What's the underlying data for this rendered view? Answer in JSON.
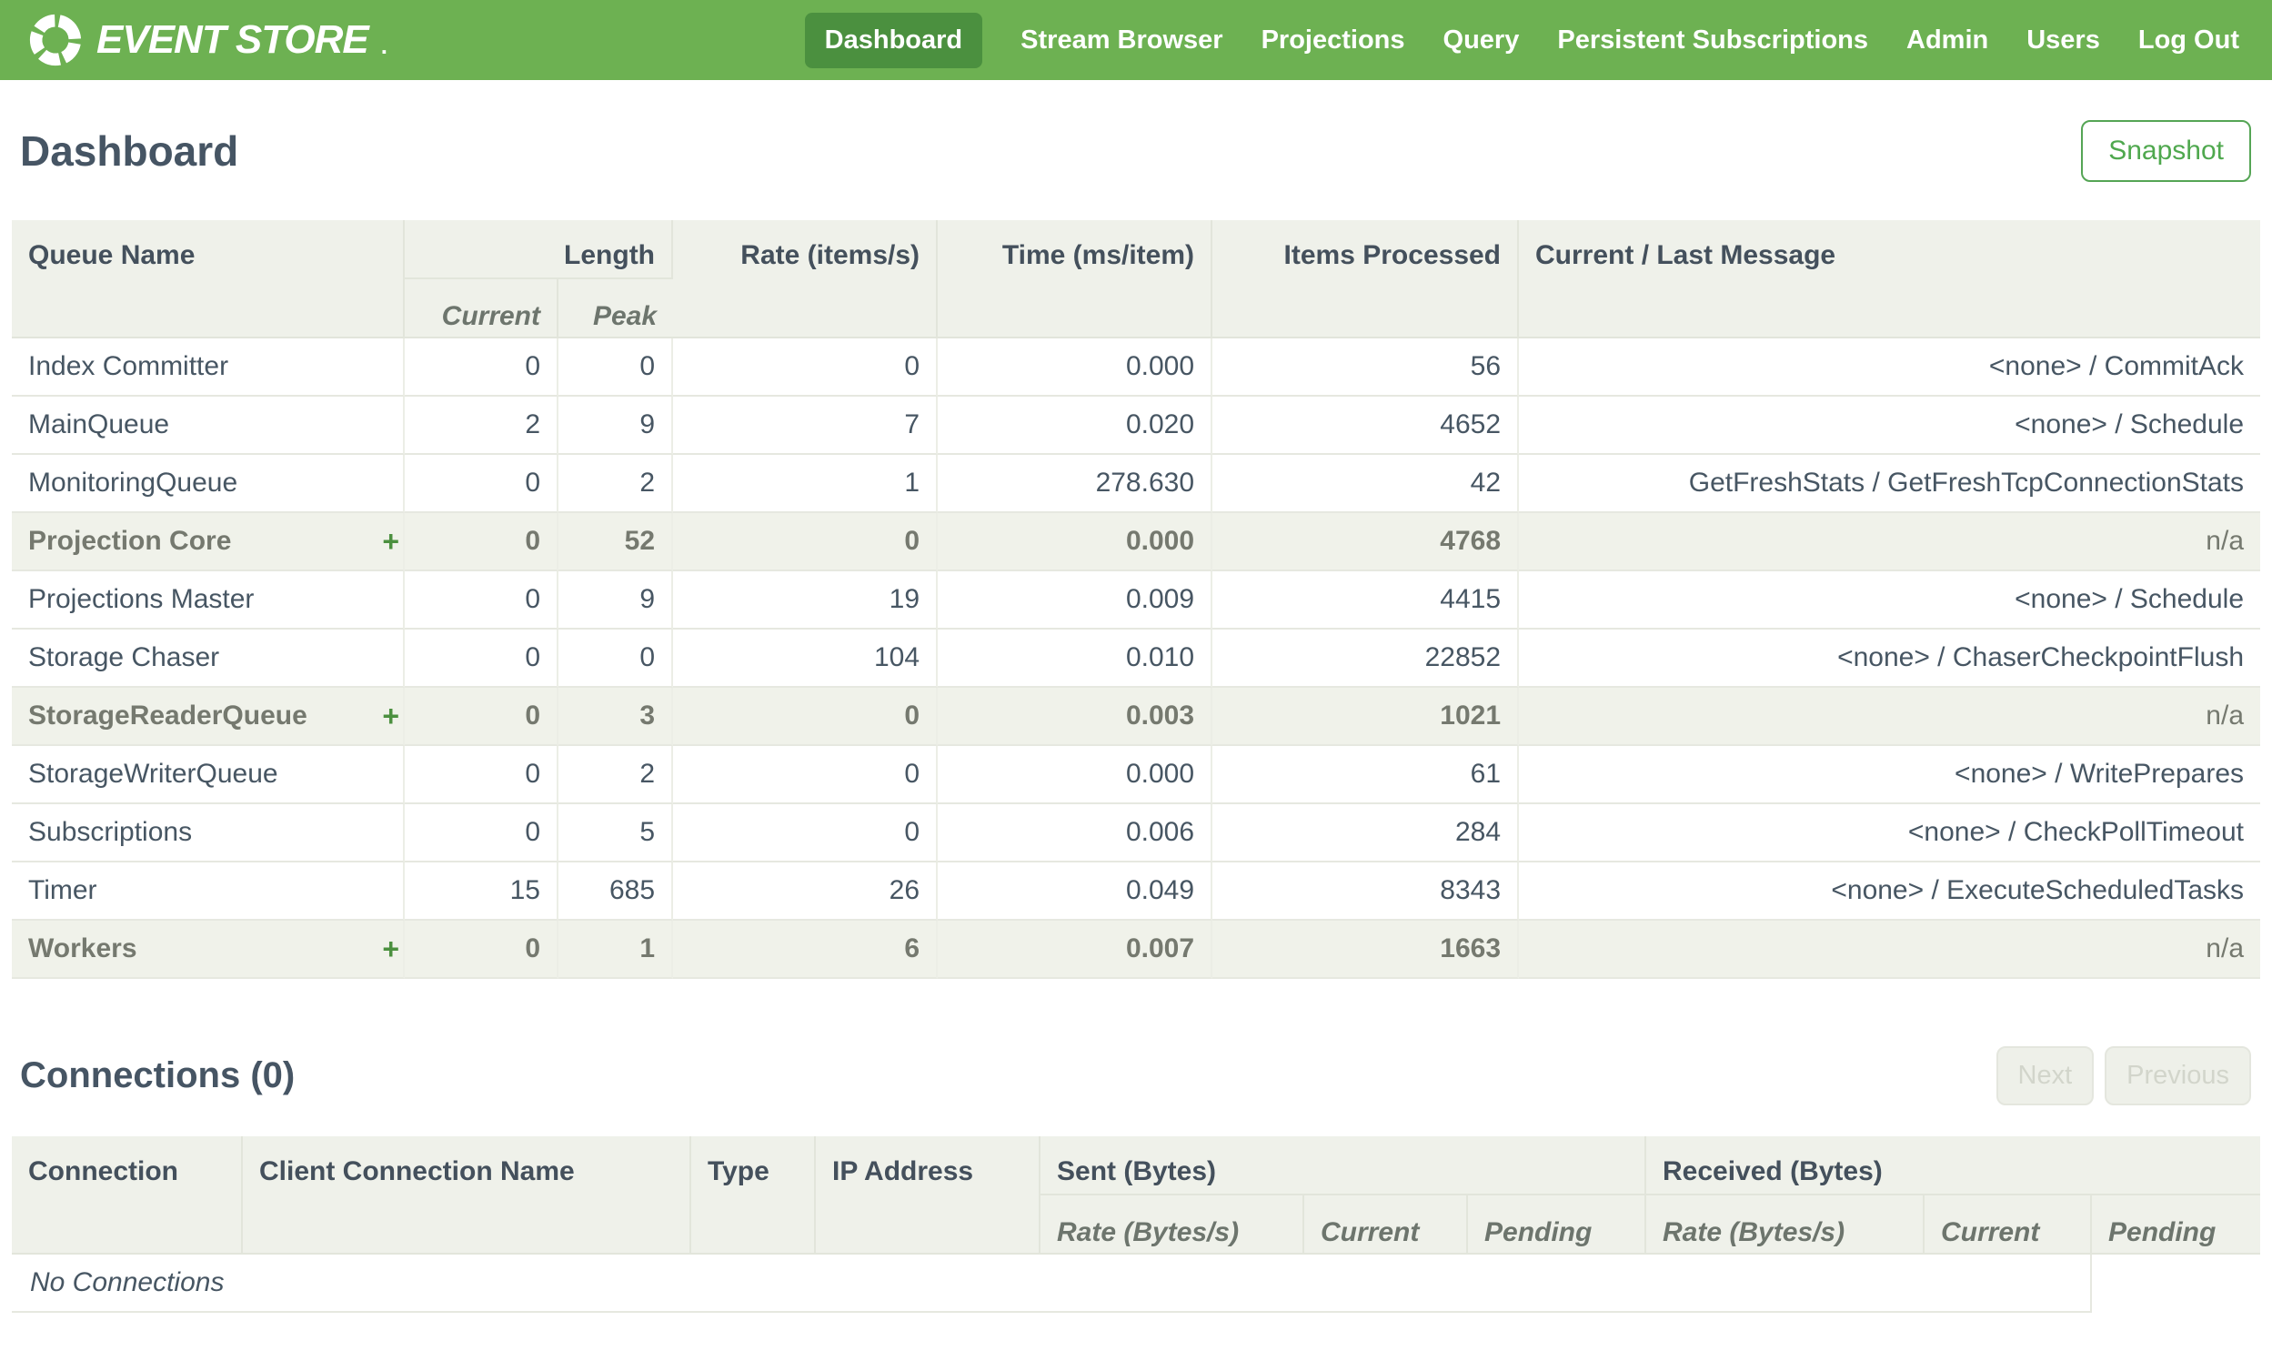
{
  "colors": {
    "nav_green": "#6db152",
    "nav_active_green": "#4b903f",
    "accent_green": "#4fa84e",
    "header_bg": "#eff1ea",
    "group_row_bg": "#f0f2ea",
    "text_dark": "#475663",
    "text_gray": "#75796f"
  },
  "nav": {
    "brand": "EVENT STORE",
    "brand_mark": ".",
    "items": [
      {
        "label": "Dashboard",
        "active": true
      },
      {
        "label": "Stream Browser",
        "active": false
      },
      {
        "label": "Projections",
        "active": false
      },
      {
        "label": "Query",
        "active": false
      },
      {
        "label": "Persistent Subscriptions",
        "active": false
      },
      {
        "label": "Admin",
        "active": false
      },
      {
        "label": "Users",
        "active": false
      },
      {
        "label": "Log Out",
        "active": false
      }
    ]
  },
  "page": {
    "title": "Dashboard",
    "snapshot_button": "Snapshot"
  },
  "queue_table": {
    "headers": {
      "queue_name": "Queue Name",
      "length": "Length",
      "current": "Current",
      "peak": "Peak",
      "rate": "Rate (items/s)",
      "time": "Time (ms/item)",
      "items_processed": "Items Processed",
      "message": "Current / Last Message"
    },
    "rows": [
      {
        "name": "Index Committer",
        "group": false,
        "expander": "",
        "current": "0",
        "peak": "0",
        "rate": "0",
        "time": "0.000",
        "items": "56",
        "message": "<none> / CommitAck"
      },
      {
        "name": "MainQueue",
        "group": false,
        "expander": "",
        "current": "2",
        "peak": "9",
        "rate": "7",
        "time": "0.020",
        "items": "4652",
        "message": "<none> / Schedule"
      },
      {
        "name": "MonitoringQueue",
        "group": false,
        "expander": "",
        "current": "0",
        "peak": "2",
        "rate": "1",
        "time": "278.630",
        "items": "42",
        "message": "GetFreshStats / GetFreshTcpConnectionStats"
      },
      {
        "name": "Projection Core",
        "group": true,
        "expander": "+",
        "current": "0",
        "peak": "52",
        "rate": "0",
        "time": "0.000",
        "items": "4768",
        "message": "n/a"
      },
      {
        "name": "Projections Master",
        "group": false,
        "expander": "",
        "current": "0",
        "peak": "9",
        "rate": "19",
        "time": "0.009",
        "items": "4415",
        "message": "<none> / Schedule"
      },
      {
        "name": "Storage Chaser",
        "group": false,
        "expander": "",
        "current": "0",
        "peak": "0",
        "rate": "104",
        "time": "0.010",
        "items": "22852",
        "message": "<none> / ChaserCheckpointFlush"
      },
      {
        "name": "StorageReaderQueue",
        "group": true,
        "expander": "+",
        "current": "0",
        "peak": "3",
        "rate": "0",
        "time": "0.003",
        "items": "1021",
        "message": "n/a"
      },
      {
        "name": "StorageWriterQueue",
        "group": false,
        "expander": "",
        "current": "0",
        "peak": "2",
        "rate": "0",
        "time": "0.000",
        "items": "61",
        "message": "<none> / WritePrepares"
      },
      {
        "name": "Subscriptions",
        "group": false,
        "expander": "",
        "current": "0",
        "peak": "5",
        "rate": "0",
        "time": "0.006",
        "items": "284",
        "message": "<none> / CheckPollTimeout"
      },
      {
        "name": "Timer",
        "group": false,
        "expander": "",
        "current": "15",
        "peak": "685",
        "rate": "26",
        "time": "0.049",
        "items": "8343",
        "message": "<none> / ExecuteScheduledTasks"
      },
      {
        "name": "Workers",
        "group": true,
        "expander": "+",
        "current": "0",
        "peak": "1",
        "rate": "6",
        "time": "0.007",
        "items": "1663",
        "message": "n/a"
      }
    ]
  },
  "connections": {
    "title": "Connections (0)",
    "next_button": "Next",
    "previous_button": "Previous",
    "headers": {
      "connection": "Connection",
      "client_name": "Client Connection Name",
      "type": "Type",
      "ip": "IP Address",
      "sent": "Sent (Bytes)",
      "received": "Received (Bytes)",
      "rate": "Rate (Bytes/s)",
      "current": "Current",
      "pending": "Pending"
    },
    "empty_message": "No Connections"
  }
}
